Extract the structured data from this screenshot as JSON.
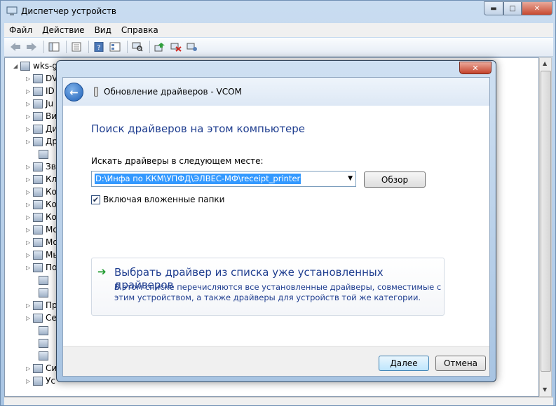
{
  "main_window": {
    "title": "Диспетчер устройств",
    "controls": {
      "minimize": "▬",
      "maximize": "□",
      "close": "✕"
    }
  },
  "menu": [
    "Файл",
    "Действие",
    "Вид",
    "Справка"
  ],
  "toolbar": {
    "icons": [
      "back-icon",
      "forward-icon",
      "console-tree-icon",
      "properties-icon",
      "help-icon",
      "details-icon",
      "scan-hardware-icon",
      "update-driver-icon",
      "disable-device-icon",
      "uninstall-device-icon"
    ]
  },
  "tree": {
    "root": "wks-g",
    "items": [
      "DV",
      "ID",
      "Ju",
      "Ви",
      "Ди",
      "Др",
      "",
      "Зв",
      "Кл",
      "Ко",
      "Ко",
      "Ко",
      "Мо",
      "Мо",
      "Мы",
      "По",
      "",
      "",
      "Пр",
      "Се",
      "",
      "",
      "",
      "Си",
      "Ус"
    ]
  },
  "dialog": {
    "title": "Обновление драйверов - VCOM",
    "close": "✕",
    "heading": "Поиск драйверов на этом компьютере",
    "search_label": "Искать драйверы в следующем месте:",
    "path_value": "D:\\Инфа по ККМ\\УПФД\\ЭЛВЕС-МФ\\receipt_printer",
    "browse_label": "Обзор",
    "include_subfolders_label": "Включая вложенные папки",
    "include_subfolders_checked": true,
    "choose": {
      "title": "Выбрать драйвер из списка уже установленных драйверов",
      "description": "В этом списке перечисляются все установленные драйверы, совместимые с этим устройством, а также драйверы для устройств той же категории."
    },
    "next_label": "Далее",
    "cancel_label": "Отмена"
  },
  "colors": {
    "link_blue": "#1e3d8f",
    "selection": "#3399ff",
    "arrow_green": "#1d9a2d"
  }
}
